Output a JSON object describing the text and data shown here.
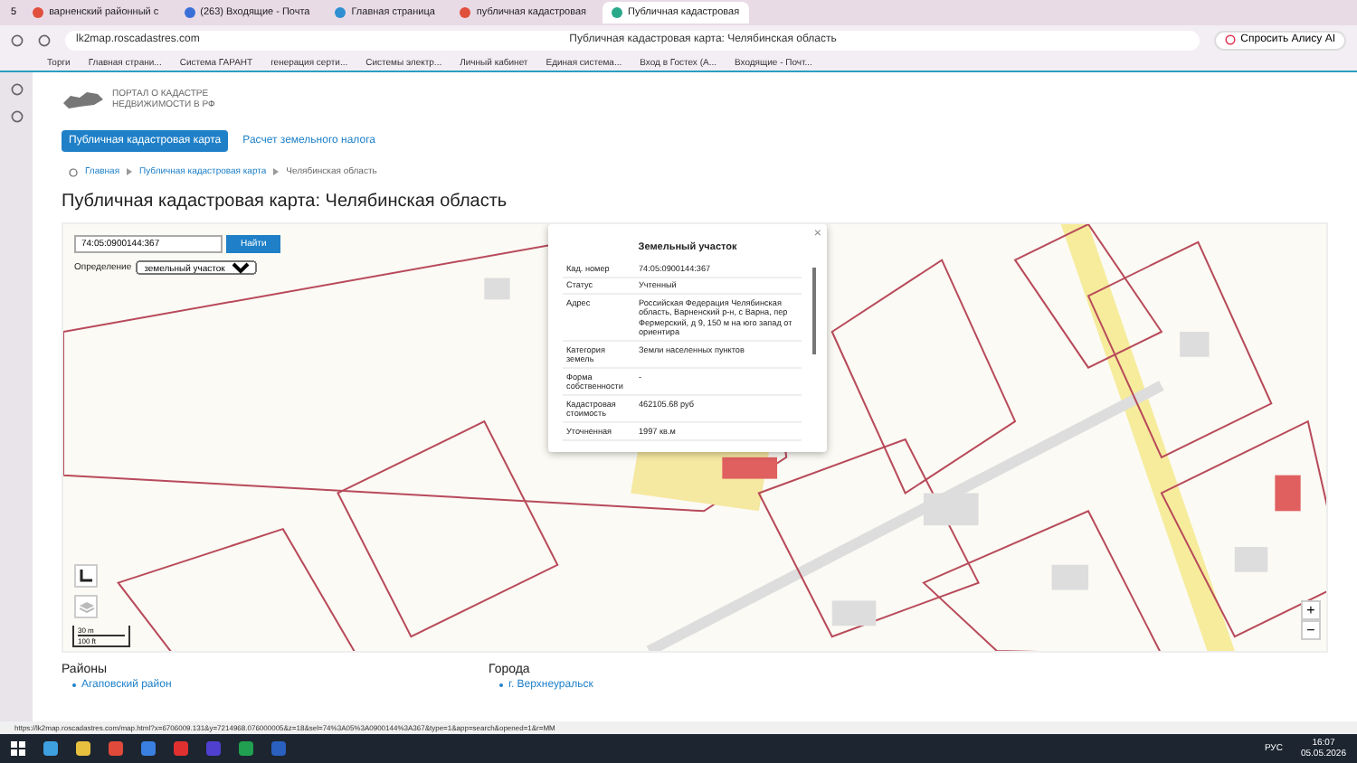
{
  "browser": {
    "tab_count": "5",
    "tabs": [
      {
        "label": "варненский районный с",
        "selected": false,
        "color": "#e0503c"
      },
      {
        "label": "(263) Входящие - Почта",
        "selected": false,
        "color": "#3a6fd8"
      },
      {
        "label": "Главная страница",
        "selected": false,
        "color": "#2f8fd0"
      },
      {
        "label": "публичная кадастровая",
        "selected": false,
        "color": "#e0503c"
      },
      {
        "label": "Публичная кадастровая",
        "selected": true,
        "color": "#2aa88a"
      }
    ],
    "address": "lk2map.roscadastres.com",
    "page_title": "Публичная кадастровая карта: Челябинская область",
    "assistant": "Спросить Алису AI",
    "bookmarks": [
      "Торги",
      "Главная страни...",
      "Система ГАРАНТ",
      "генерация серти...",
      "Системы электр...",
      "Личный кабинет",
      "Единая система...",
      "Вход в Гостех (А...",
      "Входящие - Почт..."
    ]
  },
  "header": {
    "logo_line1": "ПОРТАЛ О КАДАСТРЕ",
    "logo_line2": "НЕДВИЖИМОСТИ В РФ"
  },
  "nav": [
    {
      "label": "Публичная кадастровая карта",
      "selected": true
    },
    {
      "label": "Расчет земельного налога",
      "selected": false
    }
  ],
  "breadcrumbs": [
    "Главная",
    "Публичная кадастровая карта",
    "Челябинская область"
  ],
  "title": "Публичная кадастровая карта: Челябинская область",
  "map": {
    "search": {
      "value": "74:05:0900144:367",
      "button": "Найти"
    },
    "mode_label": "Определение",
    "mode_value": "земельный участок",
    "popup": {
      "title": "Земельный участок",
      "close": "×",
      "rows": [
        {
          "label": "Кад. номер",
          "value": "74:05:0900144:367"
        },
        {
          "label": "Статус",
          "value": "Учтенный"
        },
        {
          "label": "Адрес",
          "value": "Российская Федерация Челябинская область, Варненский р-н, с Варна, пер Фермерский, д 9, 150 м на юго запад от ориентира"
        },
        {
          "label": "Категория земель",
          "value": "Земли населенных пунктов"
        },
        {
          "label": "Форма собственности",
          "value": "-"
        },
        {
          "label": "Кадастровая стоимость",
          "value": "462105.68 руб"
        },
        {
          "label": "Уточненная",
          "value": "1997 кв.м"
        }
      ]
    },
    "scale": [
      "30 m",
      "100 ft"
    ],
    "zoom_in": "+",
    "zoom_out": "−"
  },
  "footer": [
    {
      "heading": "Районы",
      "link": "Агаповский район"
    },
    {
      "heading": "Города",
      "link": "г. Верхнеуральск"
    }
  ],
  "status_url": "https://lk2map.roscadastres.com/map.html?x=6706009.131&y=7214968.076000005&z=18&sel=74%3A05%3A0900144%3A367&type=1&app=search&opened=1&r=MM",
  "taskbar": {
    "lang": "РУС",
    "time": "16:07",
    "date": "05.05.2026"
  }
}
